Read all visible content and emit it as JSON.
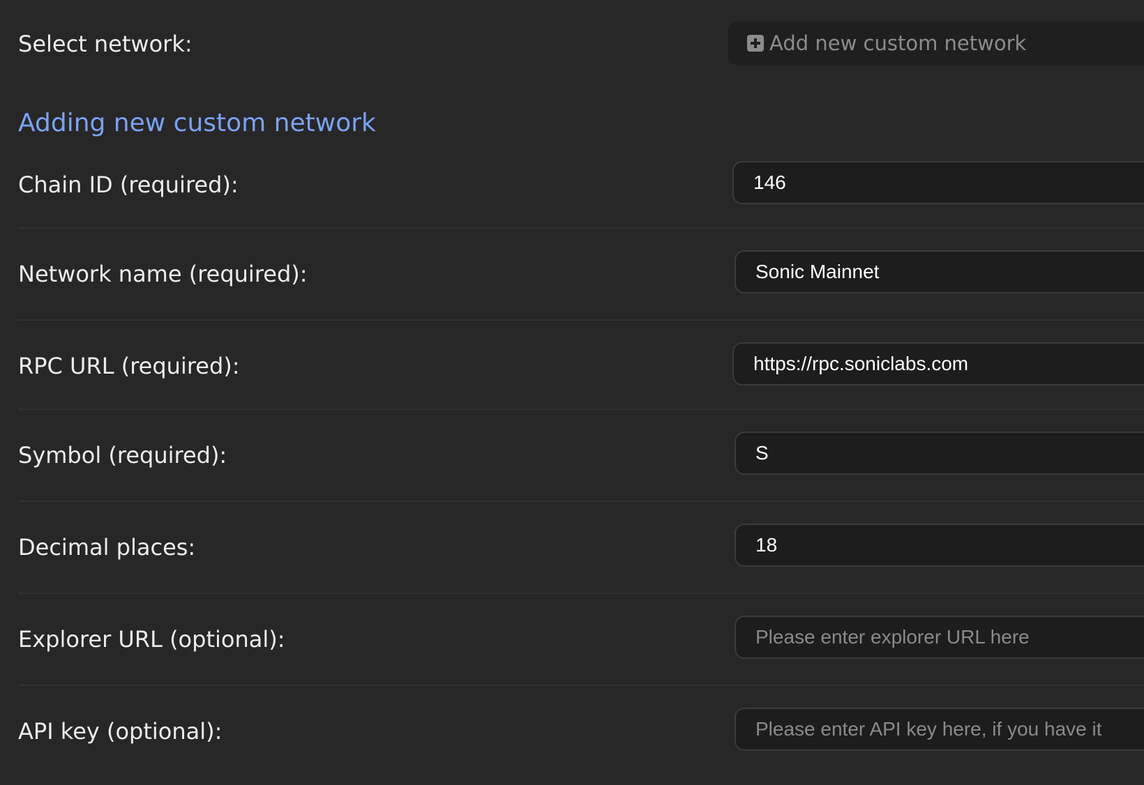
{
  "select_network": {
    "label": "Select network:",
    "add_button_label": "Add new custom network",
    "add_button_icon": "plus-square-icon"
  },
  "form": {
    "heading": "Adding new custom network",
    "accent_color": "#7aa2f7",
    "fields": [
      {
        "label": "Chain ID (required):",
        "value": "146",
        "placeholder": ""
      },
      {
        "label": "Network name (required):",
        "value": "Sonic Mainnet",
        "placeholder": ""
      },
      {
        "label": "RPC URL (required):",
        "value": "https://rpc.soniclabs.com",
        "placeholder": ""
      },
      {
        "label": "Symbol (required):",
        "value": "S",
        "placeholder": ""
      },
      {
        "label": "Decimal places:",
        "value": "18",
        "placeholder": ""
      },
      {
        "label": "Explorer URL (optional):",
        "value": "",
        "placeholder": "Please enter explorer URL here"
      },
      {
        "label": "API key (optional):",
        "value": "",
        "placeholder": "Please enter API key here, if you have it"
      }
    ]
  }
}
